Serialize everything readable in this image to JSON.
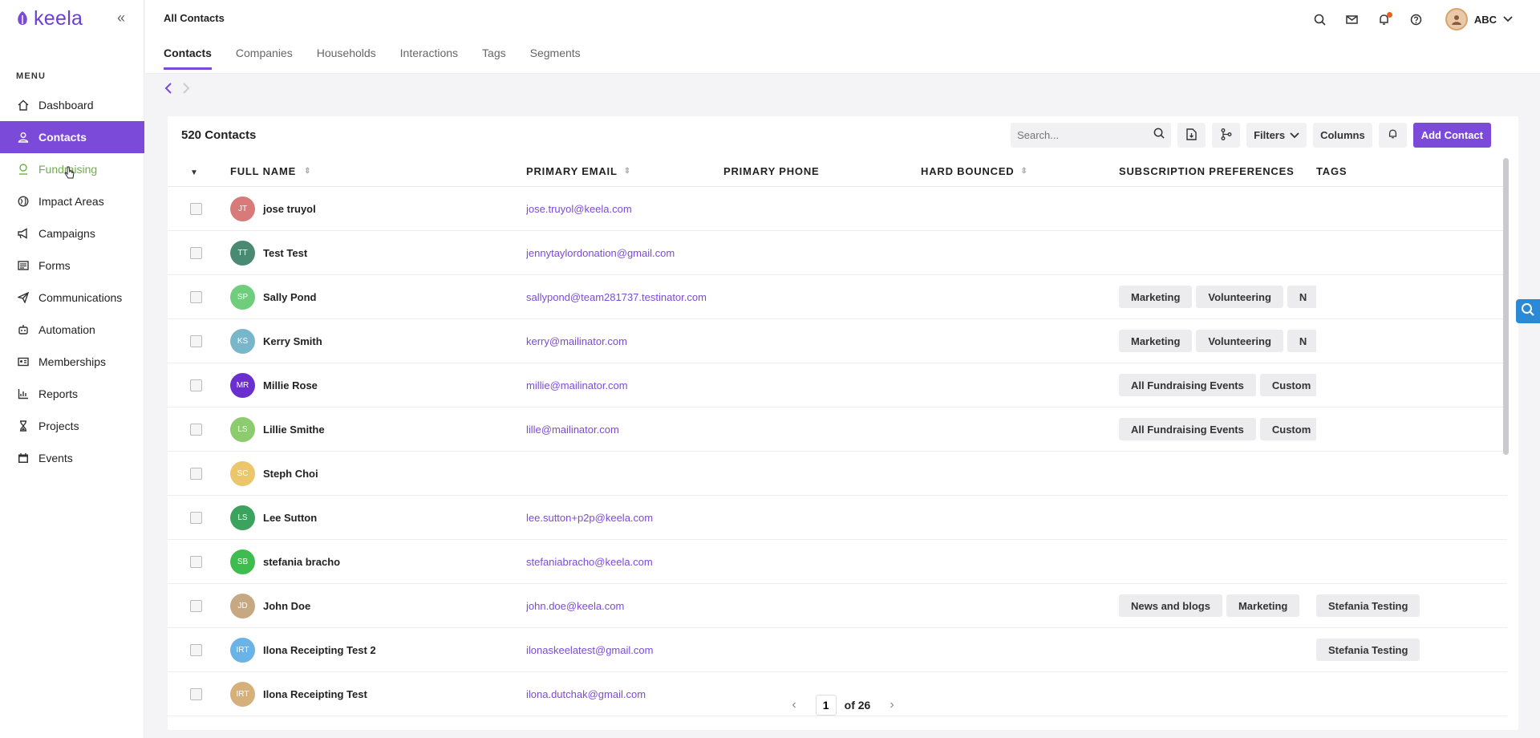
{
  "app": {
    "logo_text": "keela",
    "brand_color": "#7c4ad9"
  },
  "sidebar": {
    "menu_heading": "MENU",
    "items": [
      {
        "label": "Dashboard",
        "icon": "home-icon"
      },
      {
        "label": "Contacts",
        "icon": "person-icon",
        "active": true
      },
      {
        "label": "Fundraising",
        "icon": "fundraising-icon",
        "hover": true
      },
      {
        "label": "Impact Areas",
        "icon": "globe-icon"
      },
      {
        "label": "Campaigns",
        "icon": "megaphone-icon"
      },
      {
        "label": "Forms",
        "icon": "form-icon"
      },
      {
        "label": "Communications",
        "icon": "paper-plane-icon"
      },
      {
        "label": "Automation",
        "icon": "robot-icon"
      },
      {
        "label": "Memberships",
        "icon": "id-card-icon"
      },
      {
        "label": "Reports",
        "icon": "chart-icon"
      },
      {
        "label": "Projects",
        "icon": "hourglass-icon"
      },
      {
        "label": "Events",
        "icon": "calendar-icon"
      }
    ]
  },
  "header": {
    "title": "All Contacts",
    "tabs": [
      "Contacts",
      "Companies",
      "Households",
      "Interactions",
      "Tags",
      "Segments"
    ],
    "user_name": "ABC"
  },
  "card": {
    "title": "520 Contacts",
    "search_placeholder": "Search...",
    "filters_label": "Filters",
    "columns_label": "Columns",
    "add_label": "Add Contact"
  },
  "table": {
    "headers": {
      "name": "FULL NAME",
      "email": "PRIMARY EMAIL",
      "phone": "PRIMARY PHONE",
      "bounced": "HARD BOUNCED",
      "subs": "SUBSCRIPTION PREFERENCES",
      "tags": "TAGS"
    },
    "rows": [
      {
        "initials": "JT",
        "color": "#d8797a",
        "name": "jose truyol",
        "email": "jose.truyol@keela.com",
        "subs": [],
        "tags": []
      },
      {
        "initials": "TT",
        "color": "#4a8a72",
        "name": "Test Test",
        "email": "jennytaylordonation@gmail.com",
        "subs": [],
        "tags": []
      },
      {
        "initials": "SP",
        "color": "#6fce7b",
        "name": "Sally Pond",
        "email": "sallypond@team281737.testinator.com",
        "subs": [
          "Marketing",
          "Volunteering",
          "N"
        ],
        "tags": []
      },
      {
        "initials": "KS",
        "color": "#78b7c9",
        "name": "Kerry Smith",
        "email": "kerry@mailinator.com",
        "subs": [
          "Marketing",
          "Volunteering",
          "N"
        ],
        "tags": []
      },
      {
        "initials": "MR",
        "color": "#6b2fd0",
        "name": "Millie Rose",
        "email": "millie@mailinator.com",
        "subs": [
          "All Fundraising Events",
          "Custom"
        ],
        "tags": []
      },
      {
        "initials": "LS",
        "color": "#8dcc6e",
        "name": "Lillie Smithe",
        "email": "lille@mailinator.com",
        "subs": [
          "All Fundraising Events",
          "Custom"
        ],
        "tags": []
      },
      {
        "initials": "SC",
        "color": "#ebc66a",
        "name": "Steph Choi",
        "email": "",
        "subs": [],
        "tags": []
      },
      {
        "initials": "LS",
        "color": "#3ba35e",
        "name": "Lee Sutton",
        "email": "lee.sutton+p2p@keela.com",
        "subs": [],
        "tags": []
      },
      {
        "initials": "SB",
        "color": "#3ebd4e",
        "name": "stefania bracho",
        "email": "stefaniabracho@keela.com",
        "subs": [],
        "tags": []
      },
      {
        "initials": "JD",
        "color": "#c6a882",
        "name": "John Doe",
        "email": "john.doe@keela.com",
        "subs": [
          "News and blogs",
          "Marketing"
        ],
        "tags": [
          "Stefania Testing"
        ]
      },
      {
        "initials": "IRT",
        "color": "#6ab3e6",
        "name": "Ilona Receipting Test 2",
        "email": "ilonaskeelatest@gmail.com",
        "subs": [],
        "tags": [
          "Stefania Testing"
        ]
      },
      {
        "initials": "IRT",
        "color": "#d6b07a",
        "name": "Ilona Receipting Test",
        "email": "ilona.dutchak@gmail.com",
        "subs": [],
        "tags": []
      }
    ]
  },
  "pagination": {
    "current": "1",
    "of_text": "of 26"
  }
}
